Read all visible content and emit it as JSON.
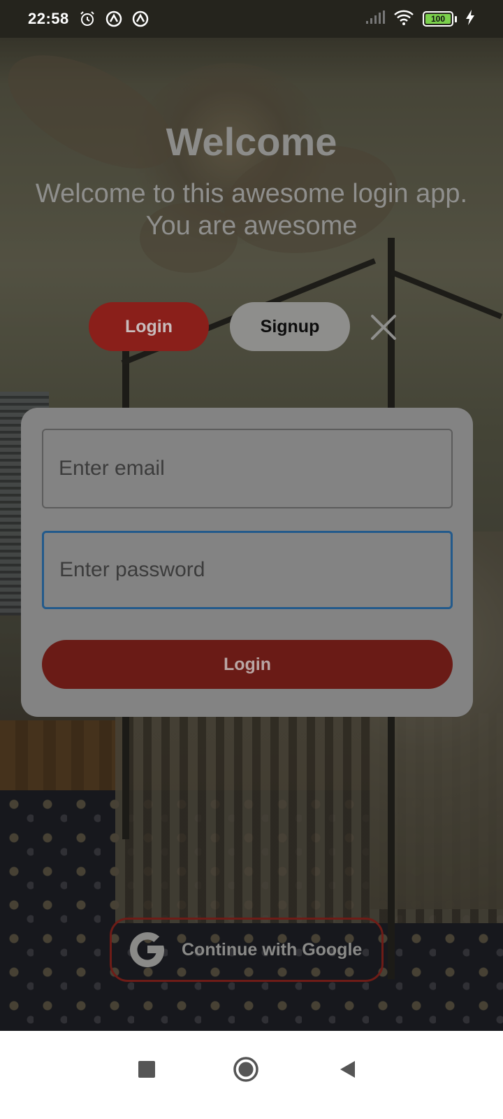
{
  "status_bar": {
    "time": "22:58",
    "icons": [
      "alarm-icon",
      "app-notification-icon",
      "app-notification-icon",
      "signal-icon",
      "wifi-icon",
      "battery-icon",
      "charging-icon"
    ],
    "battery_level": "100"
  },
  "header": {
    "title": "Welcome",
    "subtitle": "Welcome to this awesome login app. You are awesome"
  },
  "tabs": {
    "login_label": "Login",
    "signup_label": "Signup"
  },
  "form": {
    "email": {
      "placeholder": "Enter email",
      "value": ""
    },
    "password": {
      "placeholder": "Enter password",
      "value": ""
    },
    "submit_label": "Login"
  },
  "google": {
    "label": "Continue with Google"
  },
  "colors": {
    "accent_red": "#8a1f1a",
    "focus_blue": "#235a8b",
    "card_bg": "#838383"
  }
}
